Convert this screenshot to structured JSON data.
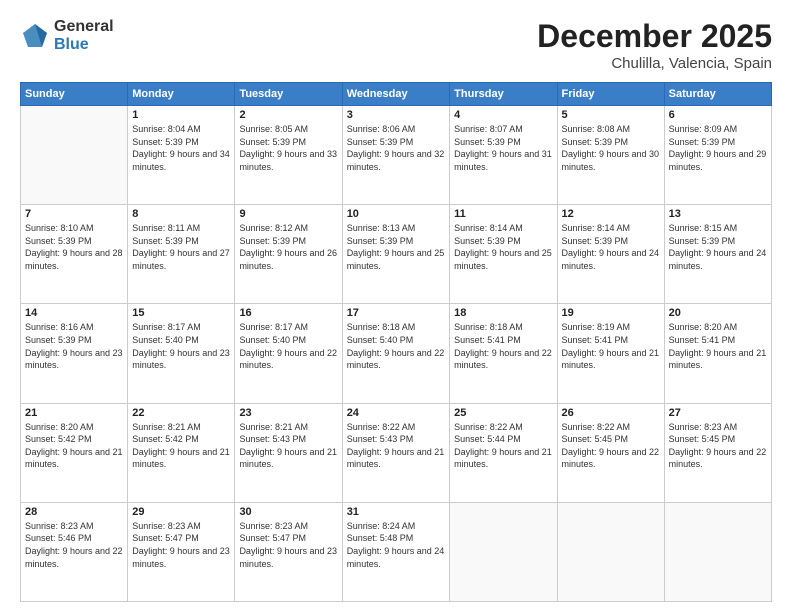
{
  "logo": {
    "general": "General",
    "blue": "Blue"
  },
  "title": "December 2025",
  "subtitle": "Chulilla, Valencia, Spain",
  "days_of_week": [
    "Sunday",
    "Monday",
    "Tuesday",
    "Wednesday",
    "Thursday",
    "Friday",
    "Saturday"
  ],
  "weeks": [
    [
      {
        "day": "",
        "sunrise": "",
        "sunset": "",
        "daylight": ""
      },
      {
        "day": "1",
        "sunrise": "Sunrise: 8:04 AM",
        "sunset": "Sunset: 5:39 PM",
        "daylight": "Daylight: 9 hours and 34 minutes."
      },
      {
        "day": "2",
        "sunrise": "Sunrise: 8:05 AM",
        "sunset": "Sunset: 5:39 PM",
        "daylight": "Daylight: 9 hours and 33 minutes."
      },
      {
        "day": "3",
        "sunrise": "Sunrise: 8:06 AM",
        "sunset": "Sunset: 5:39 PM",
        "daylight": "Daylight: 9 hours and 32 minutes."
      },
      {
        "day": "4",
        "sunrise": "Sunrise: 8:07 AM",
        "sunset": "Sunset: 5:39 PM",
        "daylight": "Daylight: 9 hours and 31 minutes."
      },
      {
        "day": "5",
        "sunrise": "Sunrise: 8:08 AM",
        "sunset": "Sunset: 5:39 PM",
        "daylight": "Daylight: 9 hours and 30 minutes."
      },
      {
        "day": "6",
        "sunrise": "Sunrise: 8:09 AM",
        "sunset": "Sunset: 5:39 PM",
        "daylight": "Daylight: 9 hours and 29 minutes."
      }
    ],
    [
      {
        "day": "7",
        "sunrise": "Sunrise: 8:10 AM",
        "sunset": "Sunset: 5:39 PM",
        "daylight": "Daylight: 9 hours and 28 minutes."
      },
      {
        "day": "8",
        "sunrise": "Sunrise: 8:11 AM",
        "sunset": "Sunset: 5:39 PM",
        "daylight": "Daylight: 9 hours and 27 minutes."
      },
      {
        "day": "9",
        "sunrise": "Sunrise: 8:12 AM",
        "sunset": "Sunset: 5:39 PM",
        "daylight": "Daylight: 9 hours and 26 minutes."
      },
      {
        "day": "10",
        "sunrise": "Sunrise: 8:13 AM",
        "sunset": "Sunset: 5:39 PM",
        "daylight": "Daylight: 9 hours and 25 minutes."
      },
      {
        "day": "11",
        "sunrise": "Sunrise: 8:14 AM",
        "sunset": "Sunset: 5:39 PM",
        "daylight": "Daylight: 9 hours and 25 minutes."
      },
      {
        "day": "12",
        "sunrise": "Sunrise: 8:14 AM",
        "sunset": "Sunset: 5:39 PM",
        "daylight": "Daylight: 9 hours and 24 minutes."
      },
      {
        "day": "13",
        "sunrise": "Sunrise: 8:15 AM",
        "sunset": "Sunset: 5:39 PM",
        "daylight": "Daylight: 9 hours and 24 minutes."
      }
    ],
    [
      {
        "day": "14",
        "sunrise": "Sunrise: 8:16 AM",
        "sunset": "Sunset: 5:39 PM",
        "daylight": "Daylight: 9 hours and 23 minutes."
      },
      {
        "day": "15",
        "sunrise": "Sunrise: 8:17 AM",
        "sunset": "Sunset: 5:40 PM",
        "daylight": "Daylight: 9 hours and 23 minutes."
      },
      {
        "day": "16",
        "sunrise": "Sunrise: 8:17 AM",
        "sunset": "Sunset: 5:40 PM",
        "daylight": "Daylight: 9 hours and 22 minutes."
      },
      {
        "day": "17",
        "sunrise": "Sunrise: 8:18 AM",
        "sunset": "Sunset: 5:40 PM",
        "daylight": "Daylight: 9 hours and 22 minutes."
      },
      {
        "day": "18",
        "sunrise": "Sunrise: 8:18 AM",
        "sunset": "Sunset: 5:41 PM",
        "daylight": "Daylight: 9 hours and 22 minutes."
      },
      {
        "day": "19",
        "sunrise": "Sunrise: 8:19 AM",
        "sunset": "Sunset: 5:41 PM",
        "daylight": "Daylight: 9 hours and 21 minutes."
      },
      {
        "day": "20",
        "sunrise": "Sunrise: 8:20 AM",
        "sunset": "Sunset: 5:41 PM",
        "daylight": "Daylight: 9 hours and 21 minutes."
      }
    ],
    [
      {
        "day": "21",
        "sunrise": "Sunrise: 8:20 AM",
        "sunset": "Sunset: 5:42 PM",
        "daylight": "Daylight: 9 hours and 21 minutes."
      },
      {
        "day": "22",
        "sunrise": "Sunrise: 8:21 AM",
        "sunset": "Sunset: 5:42 PM",
        "daylight": "Daylight: 9 hours and 21 minutes."
      },
      {
        "day": "23",
        "sunrise": "Sunrise: 8:21 AM",
        "sunset": "Sunset: 5:43 PM",
        "daylight": "Daylight: 9 hours and 21 minutes."
      },
      {
        "day": "24",
        "sunrise": "Sunrise: 8:22 AM",
        "sunset": "Sunset: 5:43 PM",
        "daylight": "Daylight: 9 hours and 21 minutes."
      },
      {
        "day": "25",
        "sunrise": "Sunrise: 8:22 AM",
        "sunset": "Sunset: 5:44 PM",
        "daylight": "Daylight: 9 hours and 21 minutes."
      },
      {
        "day": "26",
        "sunrise": "Sunrise: 8:22 AM",
        "sunset": "Sunset: 5:45 PM",
        "daylight": "Daylight: 9 hours and 22 minutes."
      },
      {
        "day": "27",
        "sunrise": "Sunrise: 8:23 AM",
        "sunset": "Sunset: 5:45 PM",
        "daylight": "Daylight: 9 hours and 22 minutes."
      }
    ],
    [
      {
        "day": "28",
        "sunrise": "Sunrise: 8:23 AM",
        "sunset": "Sunset: 5:46 PM",
        "daylight": "Daylight: 9 hours and 22 minutes."
      },
      {
        "day": "29",
        "sunrise": "Sunrise: 8:23 AM",
        "sunset": "Sunset: 5:47 PM",
        "daylight": "Daylight: 9 hours and 23 minutes."
      },
      {
        "day": "30",
        "sunrise": "Sunrise: 8:23 AM",
        "sunset": "Sunset: 5:47 PM",
        "daylight": "Daylight: 9 hours and 23 minutes."
      },
      {
        "day": "31",
        "sunrise": "Sunrise: 8:24 AM",
        "sunset": "Sunset: 5:48 PM",
        "daylight": "Daylight: 9 hours and 24 minutes."
      },
      {
        "day": "",
        "sunrise": "",
        "sunset": "",
        "daylight": ""
      },
      {
        "day": "",
        "sunrise": "",
        "sunset": "",
        "daylight": ""
      },
      {
        "day": "",
        "sunrise": "",
        "sunset": "",
        "daylight": ""
      }
    ]
  ]
}
